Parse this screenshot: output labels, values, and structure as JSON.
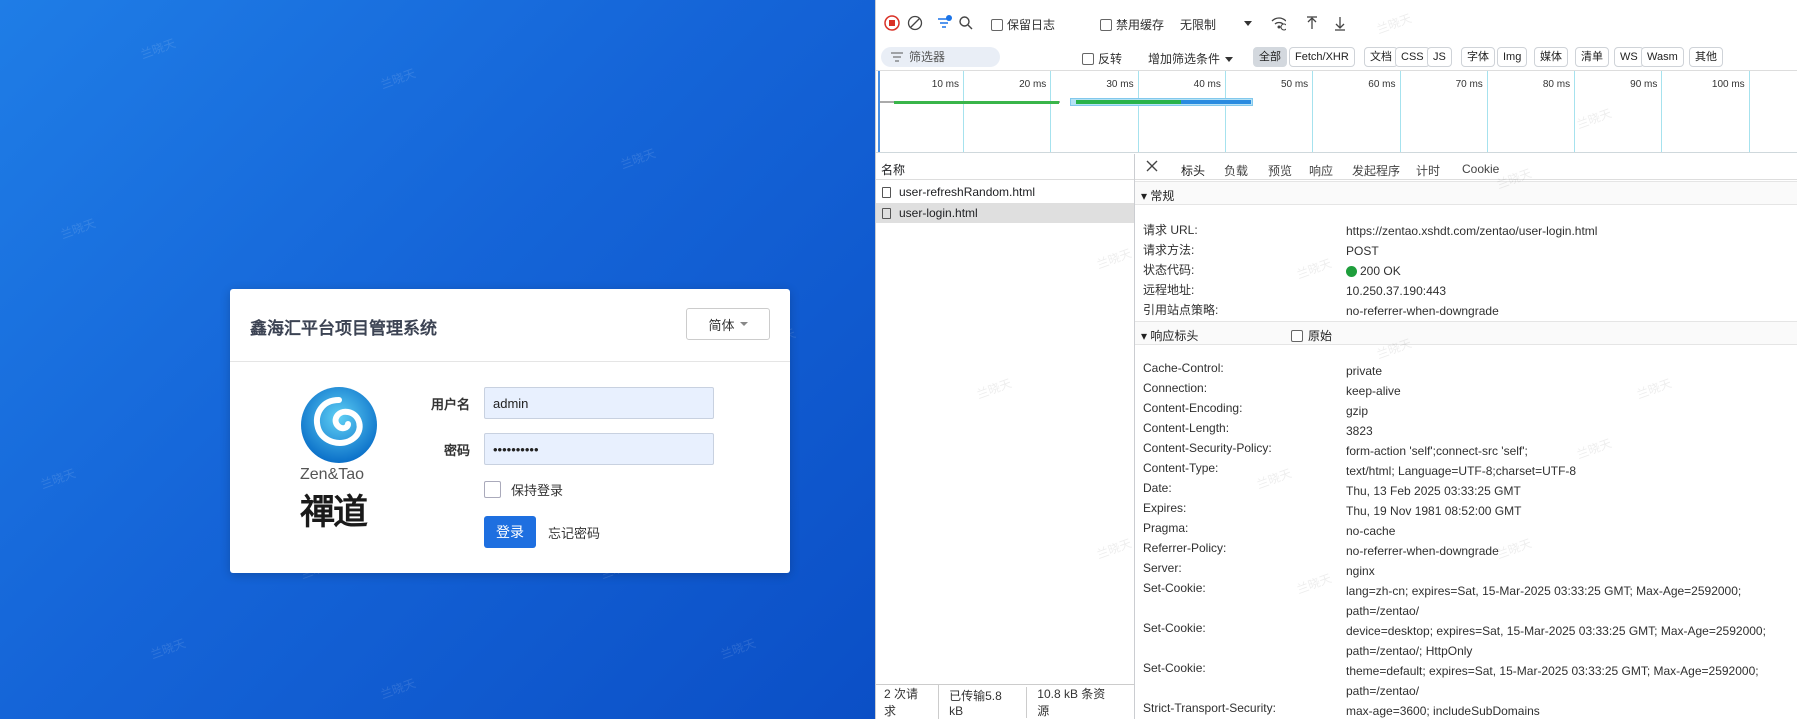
{
  "login": {
    "title": "鑫海汇平台项目管理系统",
    "lang_button": "简体",
    "logo_text": "Zen&Tao",
    "logo_cn": "禪道",
    "username_label": "用户名",
    "username_value": "admin",
    "password_label": "密码",
    "password_value": "••••••••••",
    "keep_login": "保持登录",
    "login_button": "登录",
    "forgot": "忘记密码"
  },
  "devtools": {
    "toolbar": {
      "preserve_log": "保留日志",
      "disable_cache": "禁用缓存",
      "throttle": "无限制"
    },
    "filter": {
      "placeholder": "筛选器",
      "invert": "反转",
      "more_filters": "增加筛选条件",
      "types": [
        "全部",
        "Fetch/XHR",
        "文档",
        "CSS",
        "JS",
        "字体",
        "Img",
        "媒体",
        "清单",
        "WS",
        "Wasm",
        "其他"
      ]
    },
    "timeline": {
      "ticks": [
        "10 ms",
        "20 ms",
        "30 ms",
        "40 ms",
        "50 ms",
        "60 ms",
        "70 ms",
        "80 ms",
        "90 ms",
        "100 ms"
      ]
    },
    "list": {
      "header": "名称",
      "requests": [
        "user-refreshRandom.html",
        "user-login.html"
      ]
    },
    "status": {
      "requests": "2 次请求",
      "transferred": "已传输5.8 kB",
      "resources": "10.8 kB 条资源"
    },
    "detail": {
      "tabs": [
        "标头",
        "负载",
        "预览",
        "响应",
        "发起程序",
        "计时",
        "Cookie"
      ],
      "general_title": "常规",
      "general": [
        {
          "k": "请求 URL:",
          "v": "https://zentao.xshdt.com/zentao/user-login.html"
        },
        {
          "k": "请求方法:",
          "v": "POST"
        },
        {
          "k": "状态代码:",
          "v": "200 OK"
        },
        {
          "k": "远程地址:",
          "v": "10.250.37.190:443"
        },
        {
          "k": "引用站点策略:",
          "v": "no-referrer-when-downgrade"
        }
      ],
      "response_title": "响应标头",
      "raw_label": "原始",
      "response": [
        {
          "k": "Cache-Control:",
          "v": "private"
        },
        {
          "k": "Connection:",
          "v": "keep-alive"
        },
        {
          "k": "Content-Encoding:",
          "v": "gzip"
        },
        {
          "k": "Content-Length:",
          "v": "3823"
        },
        {
          "k": "Content-Security-Policy:",
          "v": "form-action 'self';connect-src 'self';"
        },
        {
          "k": "Content-Type:",
          "v": "text/html; Language=UTF-8;charset=UTF-8"
        },
        {
          "k": "Date:",
          "v": "Thu, 13 Feb 2025 03:33:25 GMT"
        },
        {
          "k": "Expires:",
          "v": "Thu, 19 Nov 1981 08:52:00 GMT"
        },
        {
          "k": "Pragma:",
          "v": "no-cache"
        },
        {
          "k": "Referrer-Policy:",
          "v": "no-referrer-when-downgrade"
        },
        {
          "k": "Server:",
          "v": "nginx"
        },
        {
          "k": "Set-Cookie:",
          "v": "lang=zh-cn; expires=Sat, 15-Mar-2025 03:33:25 GMT; Max-Age=2592000; path=/zentao/"
        },
        {
          "k": "Set-Cookie:",
          "v": "device=desktop; expires=Sat, 15-Mar-2025 03:33:25 GMT; Max-Age=2592000; path=/zentao/; HttpOnly"
        },
        {
          "k": "Set-Cookie:",
          "v": "theme=default; expires=Sat, 15-Mar-2025 03:33:25 GMT; Max-Age=2592000; path=/zentao/"
        },
        {
          "k": "Strict-Transport-Security:",
          "v": "max-age=3600; includeSubDomains"
        }
      ]
    },
    "colors": {
      "status_ok": "#1e9e3c",
      "accent": "#1a73e8"
    }
  },
  "watermark": "兰晓天"
}
